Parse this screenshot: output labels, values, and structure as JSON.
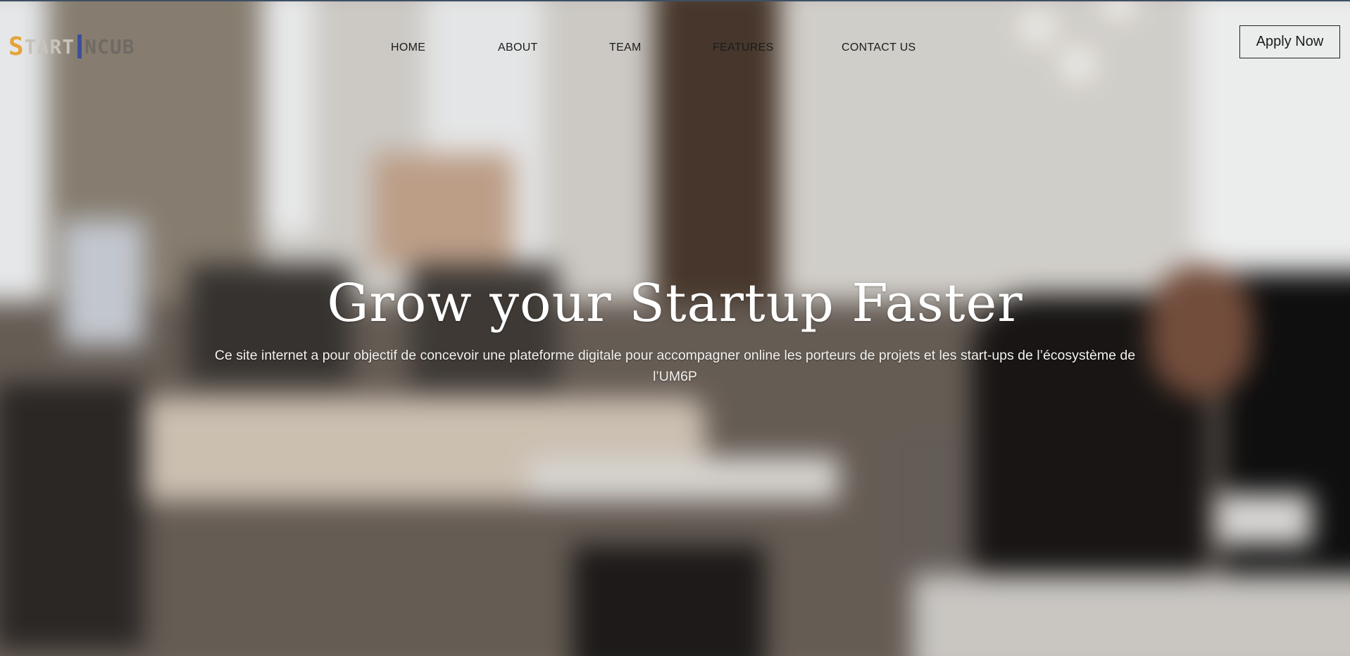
{
  "header": {
    "logo": {
      "first_letter": "S",
      "middle": "TART",
      "end": "NCUB"
    },
    "nav": [
      {
        "label": "HOME"
      },
      {
        "label": "ABOUT"
      },
      {
        "label": "TEAM"
      },
      {
        "label": "FEATURES"
      },
      {
        "label": "CONTACT US"
      }
    ],
    "apply_label": "Apply Now"
  },
  "hero": {
    "title": "Grow your Startup Faster",
    "subtitle": "Ce site internet a pour objectif de concevoir une plateforme digitale pour accompagner online les porteurs de projets et les start-ups de l’écosystème de l’UM6P"
  },
  "colors": {
    "logo_accent": "#e4a33a",
    "logo_bar": "#3e4f9a",
    "title_text": "#ffffff"
  }
}
